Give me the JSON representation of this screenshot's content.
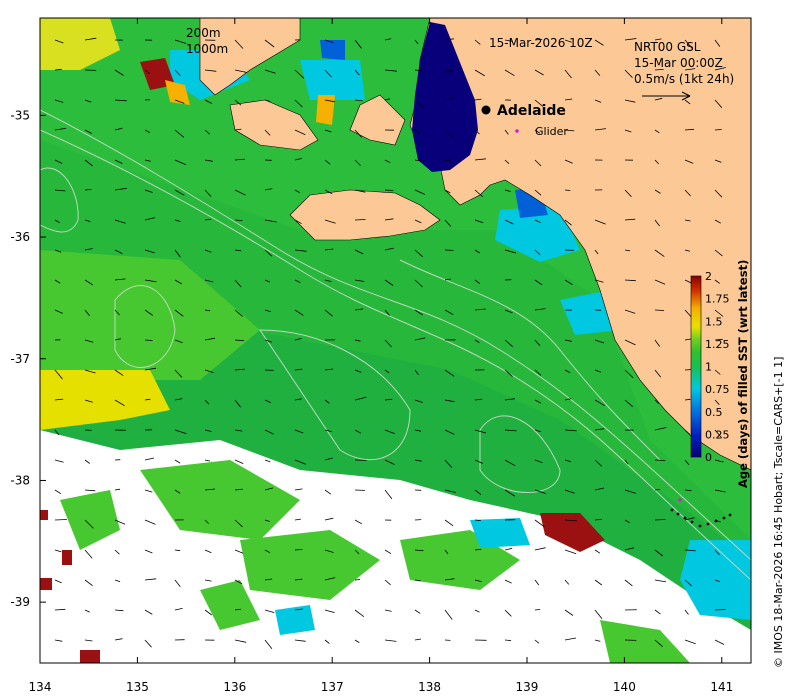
{
  "map": {
    "title_time": "15-Mar-2026 10Z",
    "product_line1": "NRT00 GSL",
    "product_line2": "15-Mar 00:00Z",
    "scale_label": "0.5m/s (1kt 24h)",
    "isobath_200": "200m",
    "isobath_1000": "1000m",
    "city": "Adelaide",
    "glider_label": "Glider",
    "credit": "© IMOS 18-Mar-2026 16:45 Hobart; Tscale=CARS+[-1 1]",
    "colors": {
      "land": "#fbc896",
      "glider": "#d020d0",
      "stale": "#9b1010"
    },
    "x_axis": {
      "ticks": [
        "134",
        "135",
        "136",
        "137",
        "138",
        "139",
        "140",
        "141"
      ],
      "lim": [
        134,
        141.3
      ]
    },
    "y_axis": {
      "ticks": [
        "-35",
        "-36",
        "-37",
        "-38",
        "-39"
      ],
      "lim": [
        -39.5,
        -34.2
      ]
    }
  },
  "colorbar": {
    "label": "Age (days) of filled SST (wrt latest)",
    "ticks": [
      "2",
      "1.75",
      "1.5",
      "1.25",
      "1",
      "0.75",
      "0.5",
      "0.25",
      "0"
    ],
    "range": [
      0,
      2
    ],
    "colors": [
      "#08007a",
      "#0020c0",
      "#0070e0",
      "#00c8e0",
      "#18c050",
      "#30c030",
      "#70d020",
      "#e8e000",
      "#f5b000",
      "#d03000",
      "#8b0000"
    ]
  }
}
